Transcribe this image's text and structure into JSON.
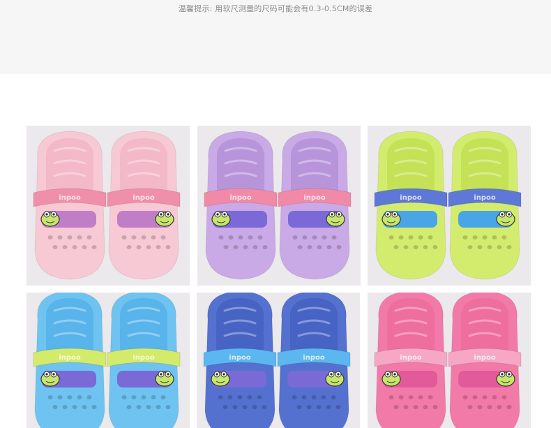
{
  "notice": {
    "text": "温馨提示: 用软尺测量的尺码可能会有0.3-0.5CM的误差"
  },
  "page": {
    "top_band_color": "#f6f6f6",
    "background_color": "#ffffff",
    "tile_background": "#ebe9eb"
  },
  "products": [
    {
      "name": "clog-pink",
      "body": "#f7c9d4",
      "inner": "#f3b9c8",
      "strap": "#f08fa9",
      "badge": "#c07ec6",
      "strap_text": "inpoo"
    },
    {
      "name": "clog-lavender",
      "body": "#c9a9e6",
      "inner": "#b895db",
      "strap": "#f18aa6",
      "badge": "#7a69d6",
      "strap_text": "inpoo"
    },
    {
      "name": "clog-lime",
      "body": "#d4ec6e",
      "inner": "#c5e256",
      "strap": "#5d78d6",
      "badge": "#4aa5e6",
      "strap_text": "inpoo"
    },
    {
      "name": "clog-skyblue",
      "body": "#6fc3f0",
      "inner": "#58b4ea",
      "strap": "#d4ea6a",
      "badge": "#7a6ad6",
      "strap_text": "inpoo"
    },
    {
      "name": "clog-royalblue",
      "body": "#5471d0",
      "inner": "#4763c4",
      "strap": "#5cb6ef",
      "badge": "#7a6ad6",
      "strap_text": "inpoo"
    },
    {
      "name": "clog-hotpink",
      "body": "#f27aa8",
      "inner": "#ee6e9e",
      "strap": "#f6a7c3",
      "badge": "#e35a9a",
      "strap_text": "inpoo"
    }
  ]
}
